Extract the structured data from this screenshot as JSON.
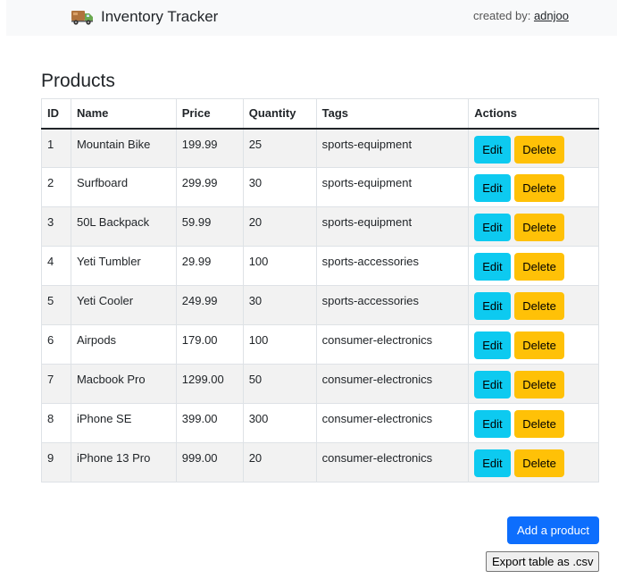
{
  "header": {
    "brand_icon": "delivery-truck-icon",
    "title": "Inventory Tracker",
    "created_by_label": "created by:",
    "author": "adnjoo"
  },
  "products_section": {
    "heading": "Products",
    "columns": [
      "ID",
      "Name",
      "Price",
      "Quantity",
      "Tags",
      "Actions"
    ],
    "rows": [
      {
        "id": "1",
        "name": "Mountain Bike",
        "price": "199.99",
        "quantity": "25",
        "tags": "sports-equipment"
      },
      {
        "id": "2",
        "name": "Surfboard",
        "price": "299.99",
        "quantity": "30",
        "tags": "sports-equipment"
      },
      {
        "id": "3",
        "name": "50L Backpack",
        "price": "59.99",
        "quantity": "20",
        "tags": "sports-equipment"
      },
      {
        "id": "4",
        "name": "Yeti Tumbler",
        "price": "29.99",
        "quantity": "100",
        "tags": "sports-accessories"
      },
      {
        "id": "5",
        "name": "Yeti Cooler",
        "price": "249.99",
        "quantity": "30",
        "tags": "sports-accessories"
      },
      {
        "id": "6",
        "name": "Airpods",
        "price": "179.00",
        "quantity": "100",
        "tags": "consumer-electronics"
      },
      {
        "id": "7",
        "name": "Macbook Pro",
        "price": "1299.00",
        "quantity": "50",
        "tags": "consumer-electronics"
      },
      {
        "id": "8",
        "name": "iPhone SE",
        "price": "399.00",
        "quantity": "300",
        "tags": "consumer-electronics"
      },
      {
        "id": "9",
        "name": "iPhone 13 Pro",
        "price": "999.00",
        "quantity": "20",
        "tags": "consumer-electronics"
      }
    ],
    "edit_label": "Edit",
    "delete_label": "Delete"
  },
  "footer_actions": {
    "add_label": "Add a product",
    "export_label": "Export table as .csv"
  },
  "colors": {
    "edit_button": "#0dcaf0",
    "delete_button": "#ffc107",
    "add_button": "#0d6efd",
    "navbar_bg": "#f8f9fa"
  }
}
